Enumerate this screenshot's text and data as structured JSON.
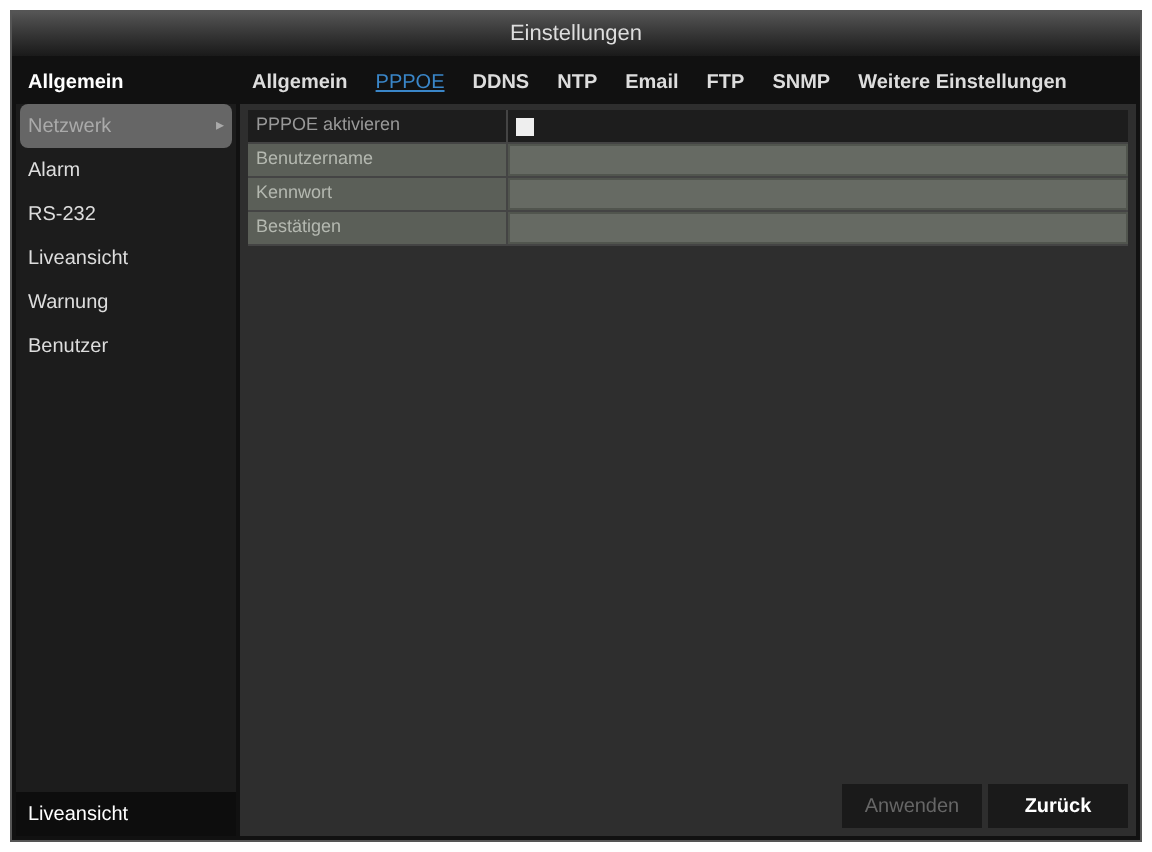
{
  "window": {
    "title": "Einstellungen"
  },
  "sidebar": {
    "header": "Allgemein",
    "items": [
      {
        "label": "Netzwerk",
        "selected": true,
        "arrow": "▸"
      },
      {
        "label": "Alarm",
        "selected": false
      },
      {
        "label": "RS-232",
        "selected": false
      },
      {
        "label": "Liveansicht",
        "selected": false
      },
      {
        "label": "Warnung",
        "selected": false
      },
      {
        "label": "Benutzer",
        "selected": false
      }
    ],
    "footer": "Liveansicht"
  },
  "tabs": [
    {
      "label": "Allgemein",
      "selected": false
    },
    {
      "label": "PPPOE",
      "selected": true
    },
    {
      "label": "DDNS",
      "selected": false
    },
    {
      "label": "NTP",
      "selected": false
    },
    {
      "label": "Email",
      "selected": false
    },
    {
      "label": "FTP",
      "selected": false
    },
    {
      "label": "SNMP",
      "selected": false
    },
    {
      "label": "Weitere Einstellungen",
      "selected": false
    }
  ],
  "form": [
    {
      "kind": "checkbox",
      "label": "PPPOE aktivieren",
      "checked": false,
      "disabled": false
    },
    {
      "kind": "text",
      "label": "Benutzername",
      "disabled": true
    },
    {
      "kind": "text",
      "label": "Kennwort",
      "disabled": true
    },
    {
      "kind": "text",
      "label": "Bestätigen",
      "disabled": true
    }
  ],
  "buttons": [
    {
      "label": "Anwenden",
      "disabled": true
    },
    {
      "label": "Zurück",
      "disabled": false
    }
  ]
}
